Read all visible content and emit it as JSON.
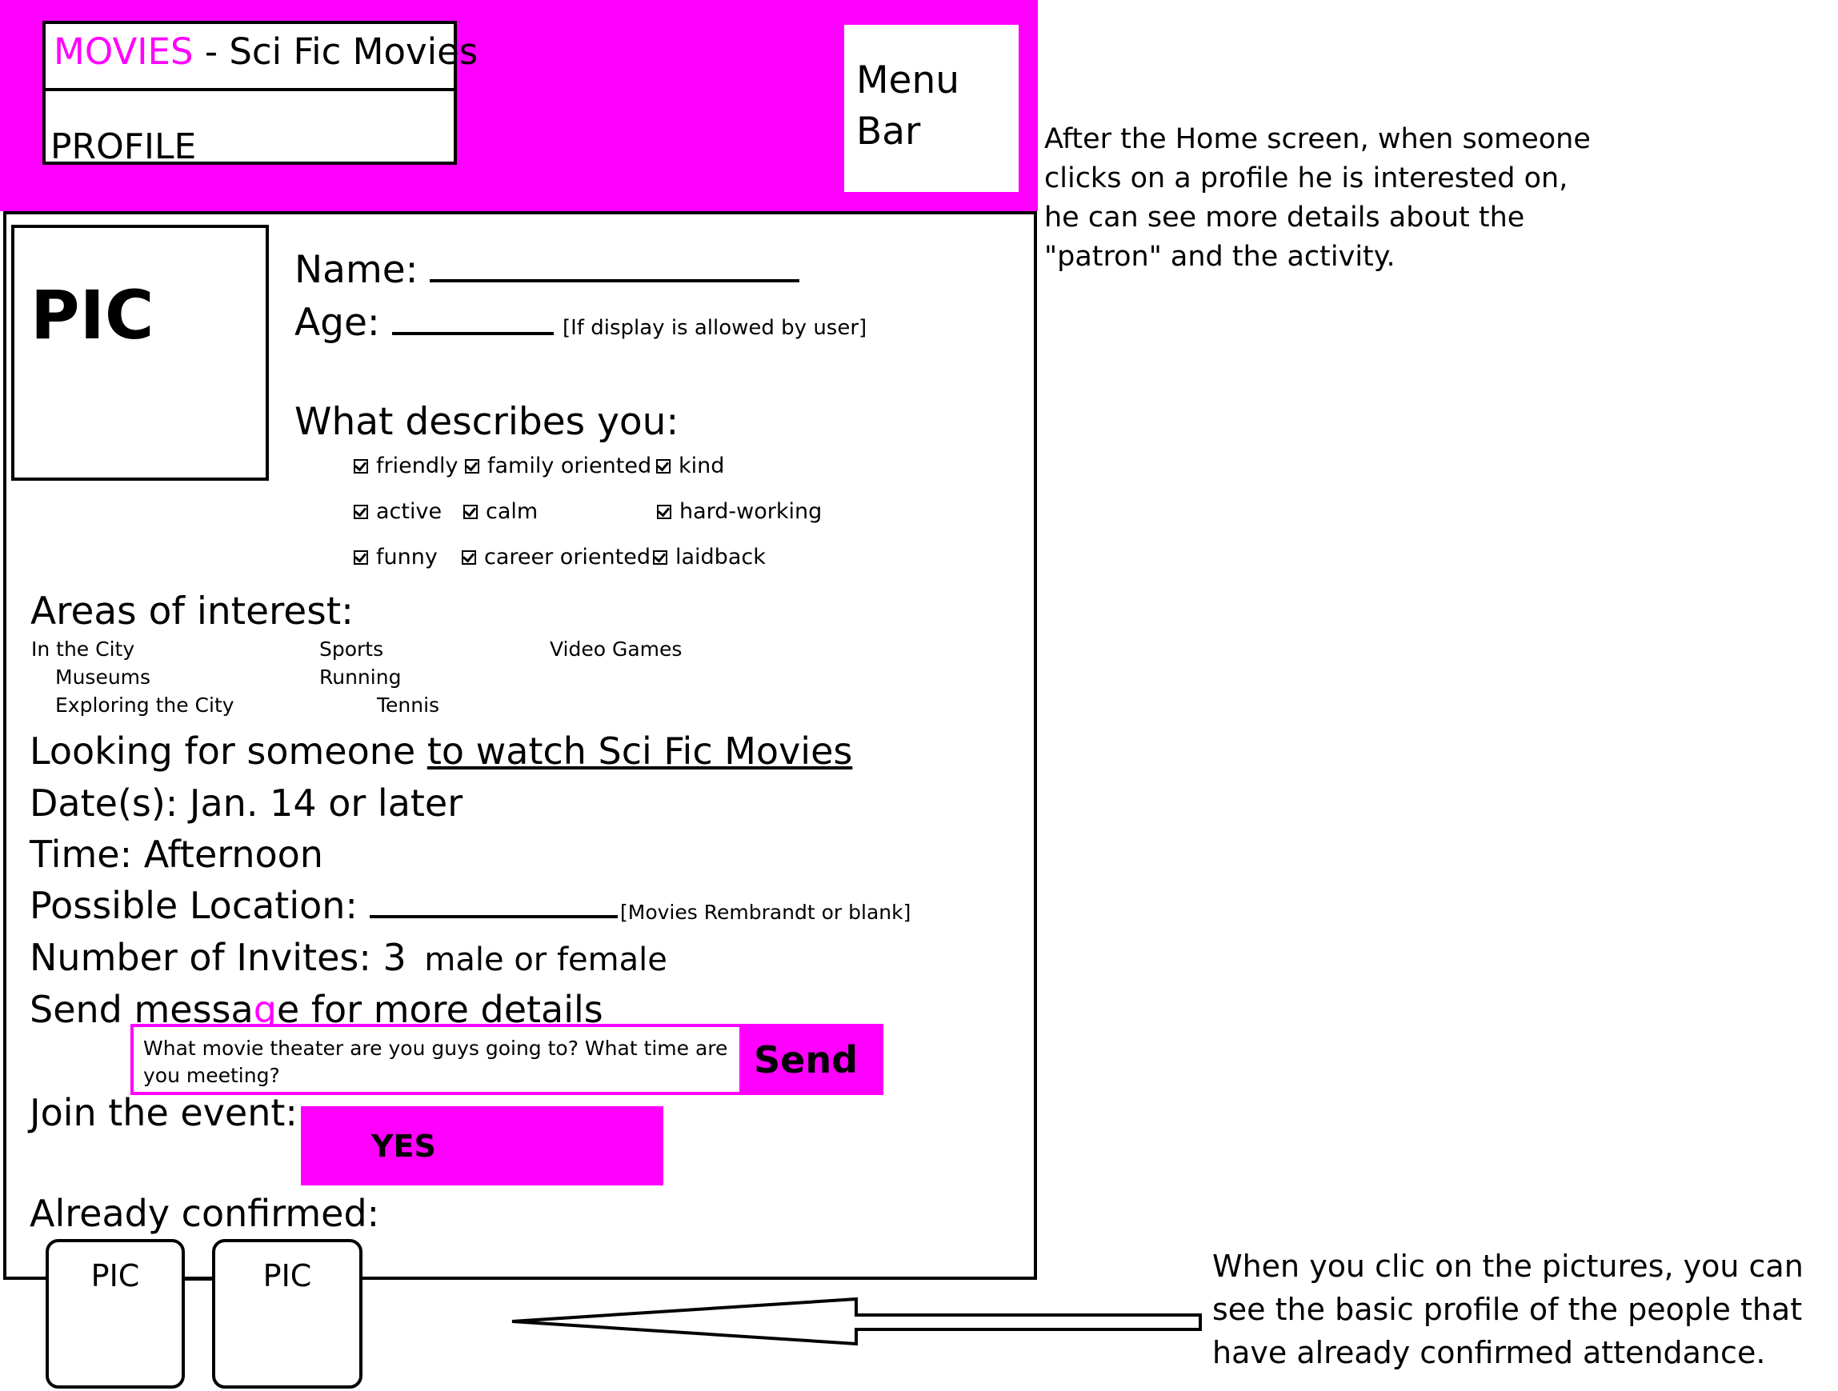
{
  "header": {
    "title_accent": "MOVIES",
    "title_rest": " - Sci Fic Movies",
    "profile_label": "PROFILE",
    "menu_label_line1": "Menu",
    "menu_label_line2": "Bar"
  },
  "profile": {
    "pic_label": "PIC",
    "name_label": "Name:",
    "age_label": "Age:",
    "age_note": "[If display is allowed by user]"
  },
  "describes": {
    "heading": "What describes you:",
    "traits": [
      "friendly",
      "family oriented",
      "kind",
      "active",
      "calm",
      "hard-working",
      "funny",
      "career oriented",
      "laidback"
    ]
  },
  "interests": {
    "heading": "Areas of interest:",
    "items": [
      "In the City",
      "Museums",
      "Exploring the City",
      "Sports",
      "Running",
      "Tennis",
      "Video Games"
    ]
  },
  "activity": {
    "looking_prefix": "Looking for someone ",
    "looking_activity": "to watch Sci Fic Movies",
    "dates": "Date(s): Jan. 14 or later",
    "time": "Time: Afternoon",
    "location_label": "Possible Location:",
    "location_note": "[Movies Rembrandt or blank]",
    "invites_label": "Number of Invites: 3",
    "invites_gender": "male or female",
    "message_label_a": "Send messa",
    "message_label_g": "g",
    "message_label_b": "e for more details",
    "message_text": "What movie theater are you guys going to? What time are you meeting?",
    "send_label": "Send",
    "join_label": "Join the event:",
    "yes_label": "YES",
    "confirmed_label": "Already confirmed:",
    "confirmed_pics": [
      "PIC",
      "PIC"
    ]
  },
  "notes": {
    "right": "After the Home screen, when someone clicks on a profile he is interested on, he can see more details about the \"patron\" and the activity.",
    "bottom": "When you clic on the pictures, you can see the basic profile of the people that have already confirmed attendance."
  },
  "colors": {
    "accent": "#ff00ff",
    "ink": "#000000",
    "paper": "#ffffff"
  }
}
